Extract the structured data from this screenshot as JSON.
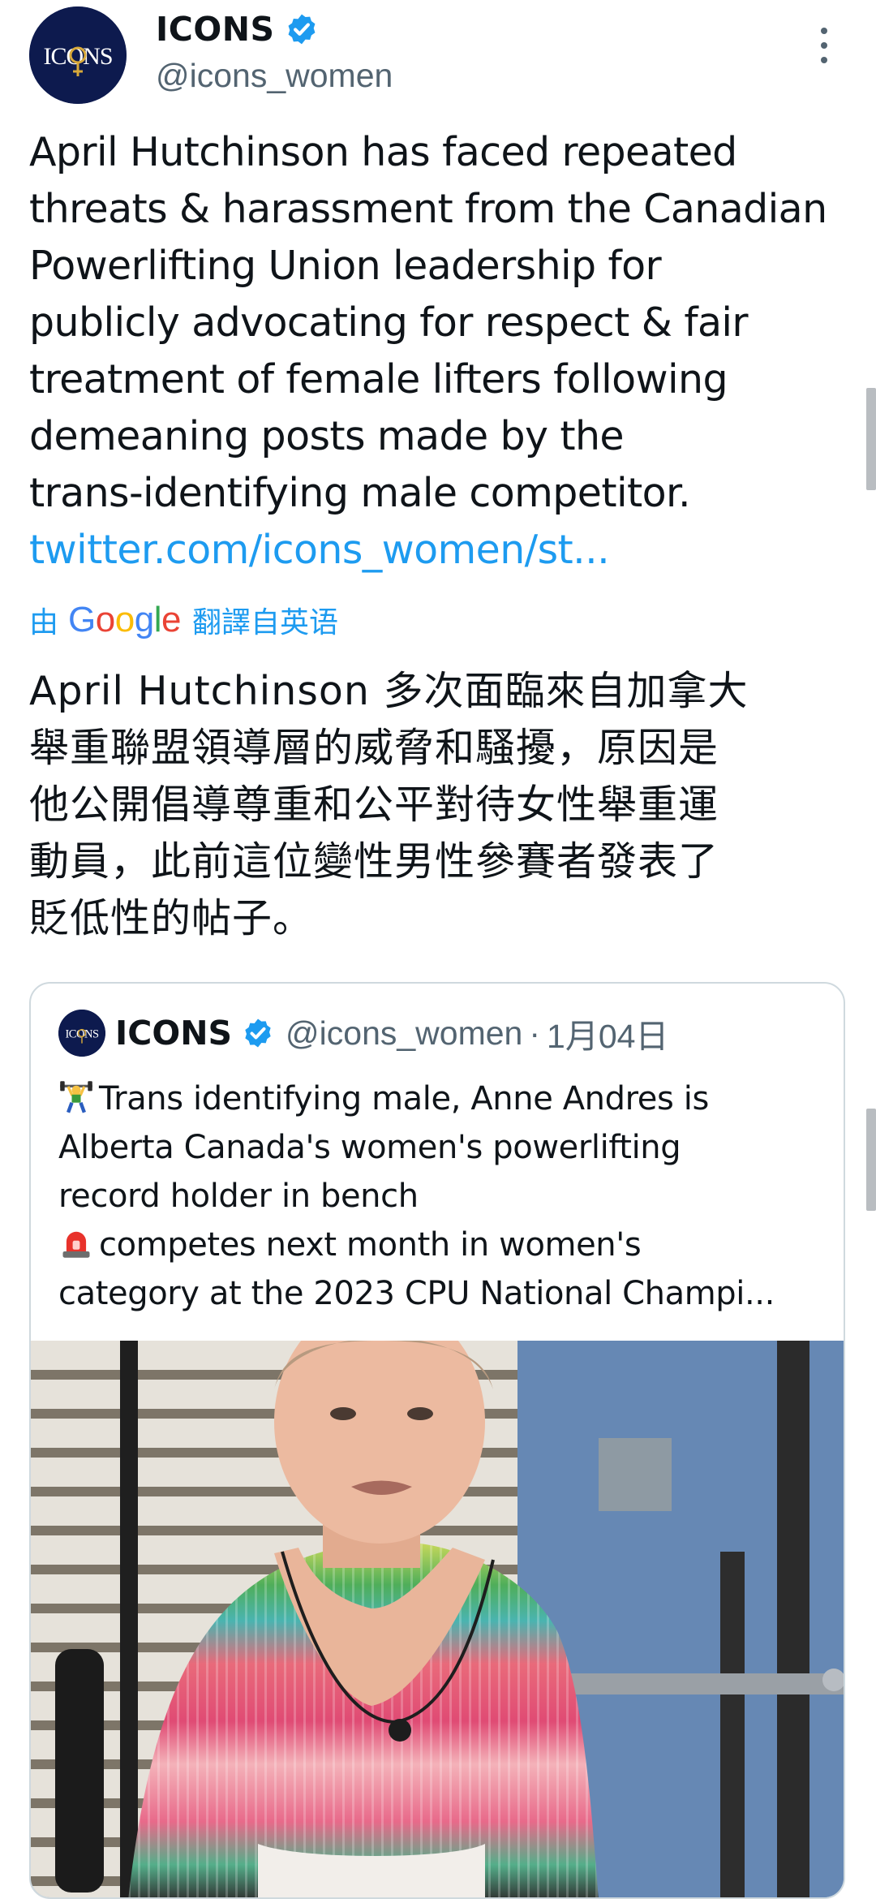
{
  "author": {
    "name": "ICONS",
    "handle": "@icons_women",
    "avatar_text": "ICONS"
  },
  "tweet": {
    "text": "April Hutchinson has faced repeated\nthreats & harassment from the Canadian\nPowerlifting Union leadership for\npublicly advocating for respect & fair\ntreatment of female lifters following\ndemeaning posts made by the\ntrans-identifying male competitor.",
    "link": "twitter.com/icons_women/st..."
  },
  "translation": {
    "prefix": "由",
    "google_parts": [
      "G",
      "o",
      "o",
      "g",
      "l",
      "e"
    ],
    "suffix": "翻譯自英语",
    "text": "April Hutchinson 多次面臨來自加拿大\n舉重聯盟領導層的威脅和騷擾，原因是\n他公開倡導尊重和公平對待女性舉重運\n動員，此前這位變性男性參賽者發表了\n貶低性的帖子。"
  },
  "quoted_tweet": {
    "name": "ICONS",
    "handle": "@icons_women",
    "separator": "·",
    "date": "1月04日",
    "lines": [
      "Trans identifying male, Anne Andres is",
      "Alberta Canada's women's powerlifting",
      "record holder in bench",
      "competes next month in women's",
      "category at the 2023 CPU National Champi..."
    ],
    "line_emojis": [
      "weightlifter-emoji",
      "",
      "",
      "siren-emoji",
      ""
    ]
  },
  "icons": {
    "verified": "verified-badge-icon",
    "more": "more-vertical-icon"
  },
  "colors": {
    "link": "#1d9bf0",
    "text": "#0f1419",
    "secondary": "#536471",
    "border": "#cfd9de",
    "avatar_bg": "#0d1a4e"
  }
}
